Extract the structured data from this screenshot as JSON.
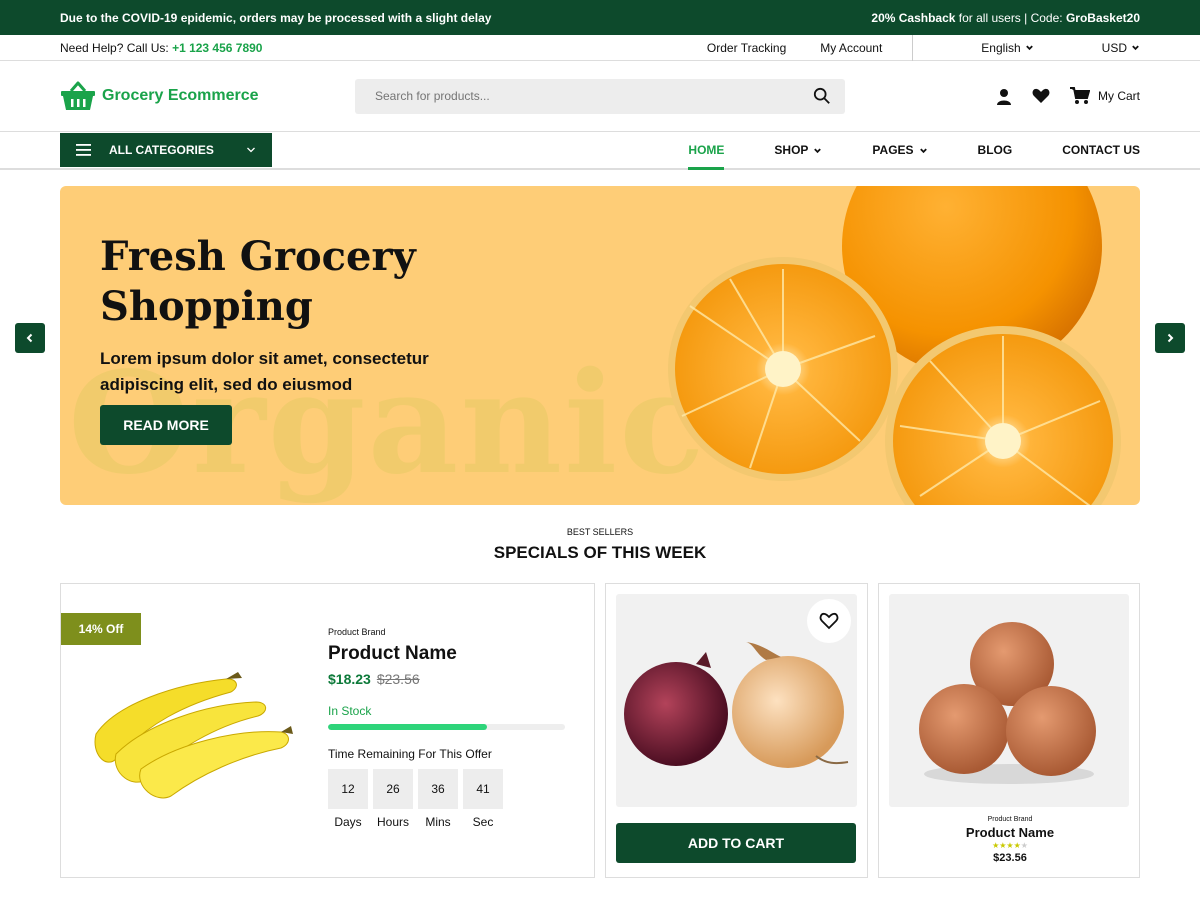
{
  "announcement": {
    "prefix": "Due to the ",
    "highlight": "COVID-19",
    "suffix": " epidemic, orders may be processed with a slight delay",
    "cashback": "20% Cashback",
    "cashback_rest": " for all users | Code: ",
    "code": "GroBasket20"
  },
  "helpbar": {
    "help_label": "Need Help? Call Us: ",
    "phone": "+1 123 456 7890",
    "order_tracking": "Order Tracking",
    "my_account": "My Account",
    "language": "English",
    "currency": "USD"
  },
  "header": {
    "logo_text": "Grocery Ecommerce",
    "search_placeholder": "Search for products...",
    "cart_label": "My Cart"
  },
  "nav": {
    "all_categories": "ALL CATEGORIES",
    "items": [
      {
        "label": "HOME",
        "active": true
      },
      {
        "label": "SHOP",
        "dropdown": true
      },
      {
        "label": "PAGES",
        "dropdown": true
      },
      {
        "label": "BLOG"
      },
      {
        "label": "CONTACT US"
      }
    ]
  },
  "hero": {
    "title": "Fresh Grocery Shopping",
    "description": "Lorem ipsum dolor sit amet, consectetur adipiscing elit, sed do eiusmod",
    "button": "READ MORE",
    "watermark": "Organic"
  },
  "specials": {
    "subtitle": "BEST SELLERS",
    "title": "SPECIALS OF THIS WEEK"
  },
  "deal": {
    "badge": "14% Off",
    "brand": "Product Brand",
    "name": "Product Name",
    "price": "$18.23",
    "old_price": "$23.56",
    "stock": "In Stock",
    "stock_fraction": 0.67,
    "timer_label": "Time Remaining For This Offer",
    "timer": [
      {
        "value": "12",
        "unit": "Days"
      },
      {
        "value": "26",
        "unit": "Hours"
      },
      {
        "value": "36",
        "unit": "Mins"
      },
      {
        "value": "41",
        "unit": "Sec"
      }
    ]
  },
  "card2": {
    "button": "ADD TO CART"
  },
  "card3": {
    "brand": "Product Brand",
    "name": "Product Name",
    "rating": 4,
    "rating_max": 5,
    "price": "$23.56"
  },
  "colors": {
    "primary_dark": "#0d4a2c",
    "accent_green": "#1aa34a",
    "hero_bg": "#fecd77",
    "badge": "#7e8f1c"
  }
}
